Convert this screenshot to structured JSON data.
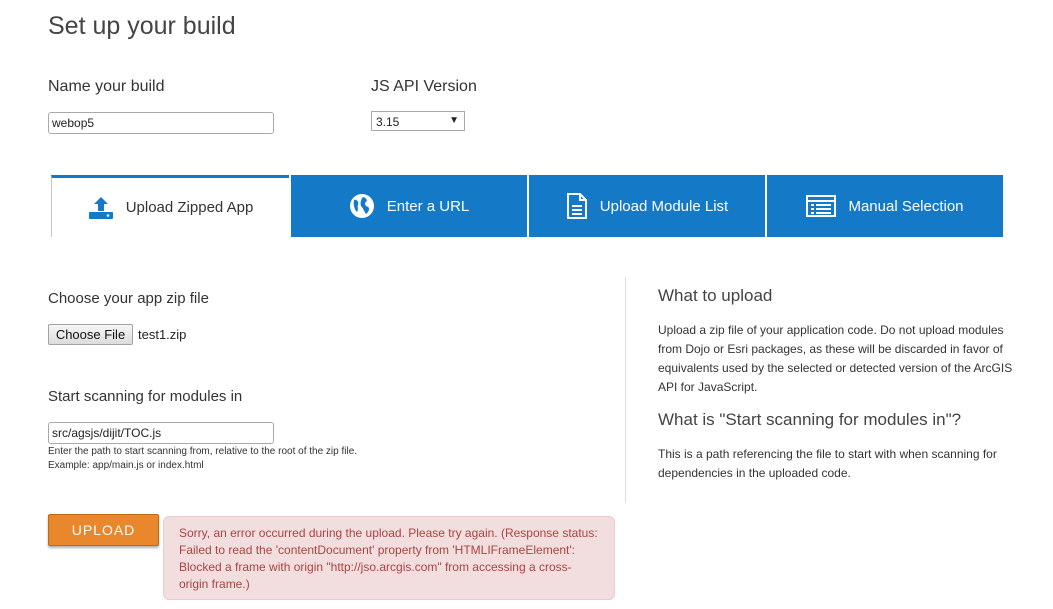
{
  "page": {
    "title": "Set up your build"
  },
  "build": {
    "label": "Name your build",
    "value": "webop5"
  },
  "version": {
    "label": "JS API Version",
    "selected": "3.15"
  },
  "tabs": [
    {
      "label": "Upload Zipped App",
      "icon": "upload-icon",
      "active": true
    },
    {
      "label": "Enter a URL",
      "icon": "globe-icon",
      "active": false
    },
    {
      "label": "Upload Module List",
      "icon": "document-icon",
      "active": false
    },
    {
      "label": "Manual Selection",
      "icon": "list-icon",
      "active": false
    }
  ],
  "zip": {
    "label": "Choose your app zip file",
    "button_label": "Choose File",
    "file_name": "test1.zip"
  },
  "scan": {
    "label": "Start scanning for modules in",
    "value": "src/agsjs/dijit/TOC.js",
    "help_line1": "Enter the path to start scanning from, relative to the root of the zip file.",
    "help_line2": "Example: app/main.js or index.html"
  },
  "upload": {
    "button_label": "UPLOAD"
  },
  "error": {
    "message": "Sorry, an error occurred during the upload. Please try again. (Response status: Failed to read the 'contentDocument' property from 'HTMLIFrameElement': Blocked a frame with origin \"http://jso.arcgis.com\" from accessing a cross-origin frame.)"
  },
  "sidebar": {
    "what_heading": "What to upload",
    "what_text": "Upload a zip file of your application code. Do not upload modules from Dojo or Esri packages, as these will be discarded in favor of equivalents used by the selected or detected version of the ArcGIS API for JavaScript.",
    "scan_heading": "What is \"Start scanning for modules in\"?",
    "scan_text": "This is a path referencing the file to start with when scanning for dependencies in the uploaded code."
  },
  "colors": {
    "tab_blue": "#1479c7",
    "upload_orange": "#e8872b",
    "error_bg": "#f2dede",
    "error_text": "#a94442"
  }
}
